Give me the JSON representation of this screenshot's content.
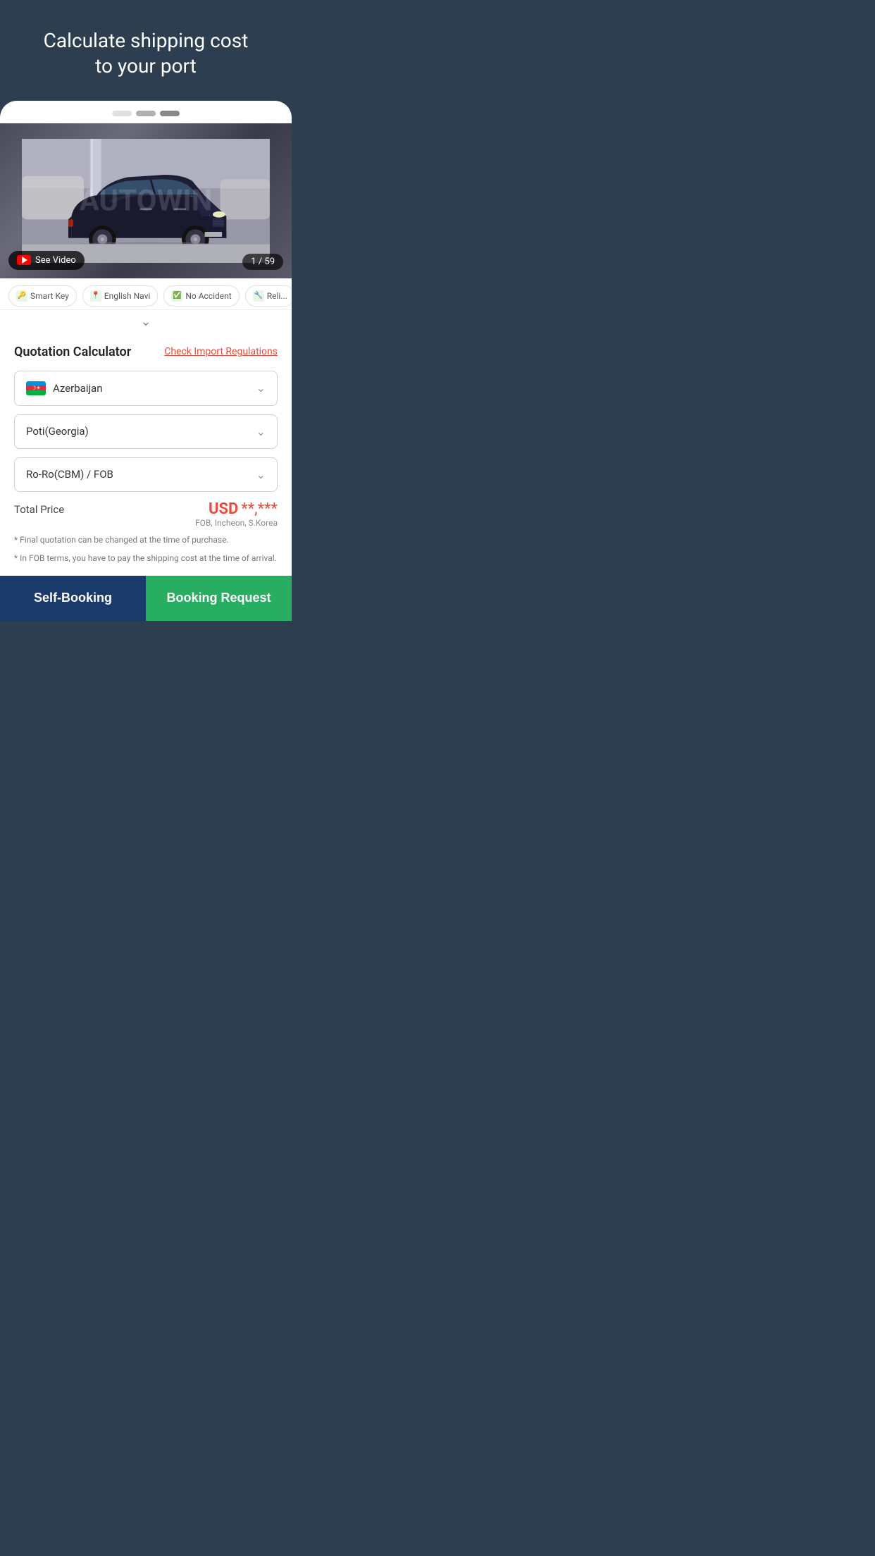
{
  "page": {
    "header_title": "Calculate shipping cost\nto your port",
    "background_color": "#2c3e50"
  },
  "pagination": {
    "dots": [
      {
        "type": "inactive"
      },
      {
        "type": "active"
      },
      {
        "type": "active-current"
      }
    ]
  },
  "car_image": {
    "watermark": "AUTOWIN",
    "see_video_label": "See Video",
    "counter": "1 / 59"
  },
  "features": [
    {
      "label": "Smart Key",
      "icon": "🔑"
    },
    {
      "label": "English Navi",
      "icon": "📍"
    },
    {
      "label": "No Accident",
      "icon": "✅"
    },
    {
      "label": "Reli...",
      "icon": "🔧"
    }
  ],
  "quotation": {
    "title": "Quotation Calculator",
    "import_link": "Check Import Regulations",
    "country_dropdown": {
      "value": "Azerbaijan",
      "has_flag": true
    },
    "port_dropdown": {
      "value": "Poti(Georgia)"
    },
    "shipping_dropdown": {
      "value": "Ro-Ro(CBM) / FOB"
    },
    "total_price_label": "Total Price",
    "price_usd": "USD",
    "price_masked": "**,***",
    "price_location": "FOB, Incheon, S.Korea",
    "footnote_1": "* Final quotation can be changed at the time of purchase.",
    "footnote_2": "* In FOB terms, you have to pay the shipping cost at the time of arrival."
  },
  "buttons": {
    "self_booking": "Self-Booking",
    "booking_request": "Booking Request"
  }
}
